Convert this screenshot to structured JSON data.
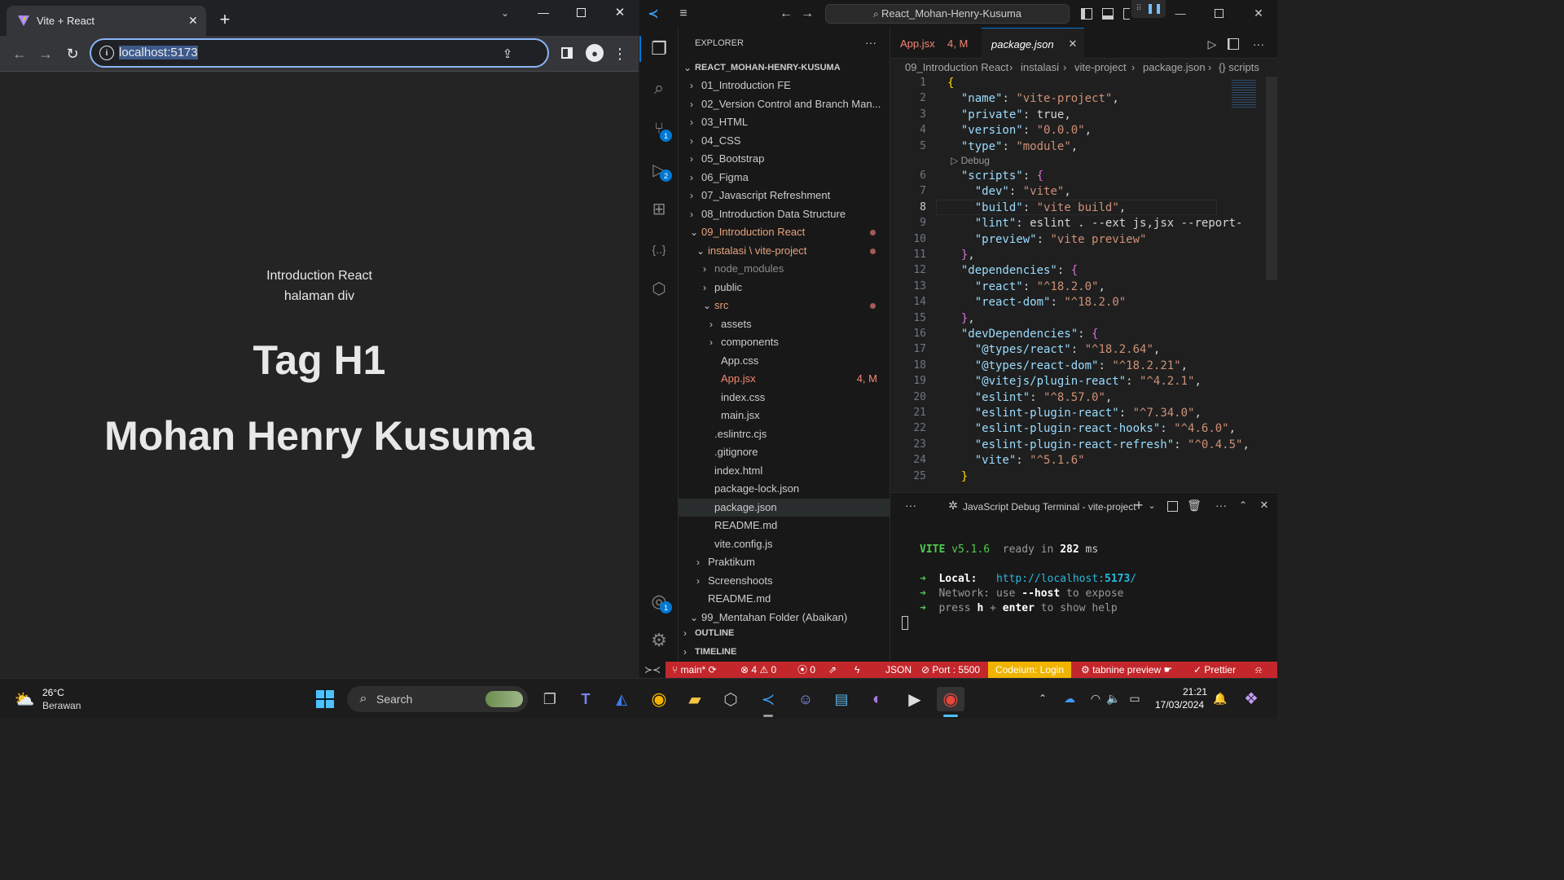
{
  "browser": {
    "tab_title": "Vite + React",
    "url": "localhost:5173",
    "page": {
      "intro": "Introduction React",
      "subtitle": "halaman div",
      "h1": "Tag H1",
      "name": "Mohan Henry Kusuma"
    }
  },
  "vscode": {
    "search_text": "React_Mohan-Henry-Kusuma",
    "explorer_title": "EXPLORER",
    "root_folder": "REACT_MOHAN-HENRY-KUSUMA",
    "tree": [
      {
        "label": "01_Introduction FE",
        "depth": 0,
        "type": "folder",
        "state": "collapsed"
      },
      {
        "label": "02_Version Control and Branch Man...",
        "depth": 0,
        "type": "folder",
        "state": "collapsed"
      },
      {
        "label": "03_HTML",
        "depth": 0,
        "type": "folder",
        "state": "collapsed"
      },
      {
        "label": "04_CSS",
        "depth": 0,
        "type": "folder",
        "state": "collapsed"
      },
      {
        "label": "05_Bootstrap",
        "depth": 0,
        "type": "folder",
        "state": "collapsed"
      },
      {
        "label": "06_Figma",
        "depth": 0,
        "type": "folder",
        "state": "collapsed"
      },
      {
        "label": "07_Javascript Refreshment",
        "depth": 0,
        "type": "folder",
        "state": "collapsed"
      },
      {
        "label": "08_Introduction Data Structure",
        "depth": 0,
        "type": "folder",
        "state": "collapsed"
      },
      {
        "label": "09_Introduction React",
        "depth": 0,
        "type": "folder",
        "state": "expanded",
        "modified": true
      },
      {
        "label": "instalasi \\ vite-project",
        "depth": 1,
        "type": "folder",
        "state": "expanded",
        "modified": true
      },
      {
        "label": "node_modules",
        "depth": 2,
        "type": "folder",
        "state": "collapsed",
        "dim": true
      },
      {
        "label": "public",
        "depth": 2,
        "type": "folder",
        "state": "collapsed"
      },
      {
        "label": "src",
        "depth": 2,
        "type": "folder",
        "state": "expanded",
        "modified": true
      },
      {
        "label": "assets",
        "depth": 3,
        "type": "folder",
        "state": "collapsed"
      },
      {
        "label": "components",
        "depth": 3,
        "type": "folder",
        "state": "collapsed"
      },
      {
        "label": "App.css",
        "depth": 3,
        "type": "file"
      },
      {
        "label": "App.jsx",
        "depth": 3,
        "type": "file",
        "badge": "4, M",
        "error": true
      },
      {
        "label": "index.css",
        "depth": 3,
        "type": "file"
      },
      {
        "label": "main.jsx",
        "depth": 3,
        "type": "file"
      },
      {
        "label": ".eslintrc.cjs",
        "depth": 2,
        "type": "file"
      },
      {
        "label": ".gitignore",
        "depth": 2,
        "type": "file"
      },
      {
        "label": "index.html",
        "depth": 2,
        "type": "file"
      },
      {
        "label": "package-lock.json",
        "depth": 2,
        "type": "file"
      },
      {
        "label": "package.json",
        "depth": 2,
        "type": "file",
        "selected": true
      },
      {
        "label": "README.md",
        "depth": 2,
        "type": "file"
      },
      {
        "label": "vite.config.js",
        "depth": 2,
        "type": "file"
      },
      {
        "label": "Praktikum",
        "depth": 1,
        "type": "folder",
        "state": "collapsed"
      },
      {
        "label": "Screenshoots",
        "depth": 1,
        "type": "folder",
        "state": "collapsed"
      },
      {
        "label": "README.md",
        "depth": 1,
        "type": "file"
      },
      {
        "label": "99_Mentahan Folder (Abaikan)",
        "depth": 0,
        "type": "folder",
        "state": "expanded"
      }
    ],
    "outline_label": "OUTLINE",
    "timeline_label": "TIMELINE",
    "tabs": [
      {
        "label": "App.jsx",
        "badge": "4, M"
      },
      {
        "label": "package.json"
      }
    ],
    "breadcrumbs": [
      "09_Introduction React",
      "instalasi",
      "vite-project",
      "package.json",
      "{} scripts"
    ],
    "codelens": "Debug",
    "code_lines": [
      "{",
      "  \"name\": \"vite-project\",",
      "  \"private\": true,",
      "  \"version\": \"0.0.0\",",
      "  \"type\": \"module\",",
      "  \"scripts\": {",
      "    \"dev\": \"vite\",",
      "    \"build\": \"vite build\",",
      "    \"lint\": \"eslint . --ext js,jsx --report-",
      "    \"preview\": \"vite preview\"",
      "  },",
      "  \"dependencies\": {",
      "    \"react\": \"^18.2.0\",",
      "    \"react-dom\": \"^18.2.0\"",
      "  },",
      "  \"devDependencies\": {",
      "    \"@types/react\": \"^18.2.64\",",
      "    \"@types/react-dom\": \"^18.2.21\",",
      "    \"@vitejs/plugin-react\": \"^4.2.1\",",
      "    \"eslint\": \"^8.57.0\",",
      "    \"eslint-plugin-react\": \"^7.34.0\",",
      "    \"eslint-plugin-react-hooks\": \"^4.6.0\",",
      "    \"eslint-plugin-react-refresh\": \"^0.4.5\",",
      "    \"vite\": \"^5.1.6\"",
      "  }"
    ],
    "line_numbers": [
      "1",
      "2",
      "3",
      "4",
      "5",
      "6",
      "7",
      "8",
      "9",
      "10",
      "11",
      "12",
      "13",
      "14",
      "15",
      "16",
      "17",
      "18",
      "19",
      "20",
      "21",
      "22",
      "23",
      "24",
      "25"
    ],
    "terminal_title": "JavaScript Debug Terminal - vite-project",
    "terminal": {
      "vite_label": "VITE",
      "vite_version": "v5.1.6",
      "ready_text": "ready in",
      "ready_ms": "282",
      "ms": "ms",
      "local_label": "Local:",
      "local_url_prefix": "http://localhost:",
      "local_port": "5173",
      "local_url_suffix": "/",
      "network_label": "Network:",
      "network_use": "use",
      "network_flag": "--host",
      "network_rest": "to expose",
      "press": "press",
      "h": "h",
      "plus": "+",
      "enter": "enter",
      "help": "to show help"
    },
    "status": {
      "branch": "main*",
      "errors": "4",
      "warnings": "0",
      "ports": "0",
      "language": "JSON",
      "port": "Port : 5500",
      "codeium": "Codeium: Login",
      "tabnine": "tabnine preview",
      "prettier": "Prettier"
    },
    "badges": {
      "scm": "1",
      "debug": "2",
      "accounts": "1"
    }
  },
  "taskbar": {
    "temperature": "26°C",
    "weather": "Berawan",
    "search_label": "Search",
    "time": "21:21",
    "date": "17/03/2024"
  },
  "colors": {
    "statusbar": "#c3272b",
    "codeium": "#f0b400",
    "accent": "#8ab4f8"
  }
}
